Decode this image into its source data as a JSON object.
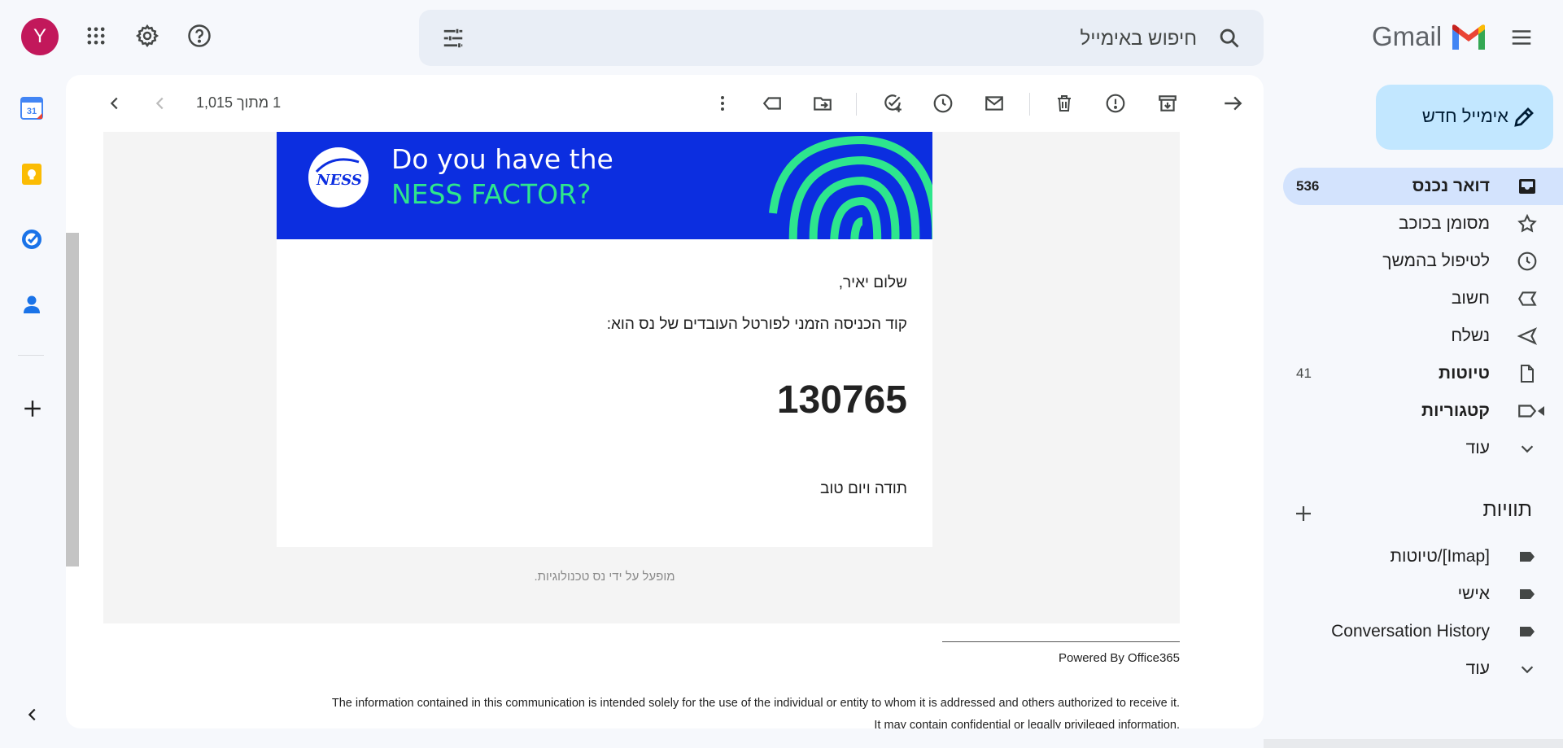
{
  "topbar": {
    "avatar_letter": "Y",
    "search_placeholder": "חיפוש באימייל",
    "logo_text": "Gmail"
  },
  "toolbar": {
    "pager_text": "1 מתוך 1,015"
  },
  "email": {
    "banner_line1": "Do you have the",
    "banner_line2": "NESS FACTOR?",
    "banner_logo_text": "NESS",
    "greeting": "שלום יאיר,",
    "code_intro": "קוד הכניסה הזמני לפורטל העובדים של נס הוא:",
    "code": "130765",
    "signoff": "תודה ויום טוב",
    "powered_note": "מופעל על ידי נס טכנולוגיות.",
    "powered_by": "Powered By Office365",
    "disclaimer_line1": "The information contained in this communication is intended solely for the use of the individual or entity to whom it is addressed and others authorized to receive it.",
    "disclaimer_line2": "It may contain confidential or legally privileged information."
  },
  "sidebar": {
    "compose_label": "אימייל חדש",
    "items": [
      {
        "label": "דואר נכנס",
        "count": "536",
        "icon": "inbox-icon"
      },
      {
        "label": "מסומן בכוכב",
        "count": "",
        "icon": "star-icon"
      },
      {
        "label": "לטיפול בהמשך",
        "count": "",
        "icon": "clock-icon"
      },
      {
        "label": "חשוב",
        "count": "",
        "icon": "important-icon"
      },
      {
        "label": "נשלח",
        "count": "",
        "icon": "send-icon"
      },
      {
        "label": "טיוטות",
        "count": "41",
        "icon": "draft-icon"
      },
      {
        "label": "קטגוריות",
        "count": "",
        "icon": "label-outline-icon"
      },
      {
        "label": "עוד",
        "count": "",
        "icon": "chevron-down-icon"
      }
    ],
    "labels_title": "תוויות",
    "labels": [
      {
        "label": "[Imap]/טיוטות",
        "icon": "label-icon"
      },
      {
        "label": "אישי",
        "icon": "label-icon"
      },
      {
        "label": "Conversation History",
        "icon": "label-icon"
      },
      {
        "label": "עוד",
        "icon": "chevron-down-icon"
      }
    ]
  },
  "colors": {
    "accent": "#c2e7ff",
    "active_nav": "#d3e3fd",
    "avatar": "#c2185b",
    "banner_blue": "#0c2ee0",
    "banner_green": "#2ee68d"
  }
}
